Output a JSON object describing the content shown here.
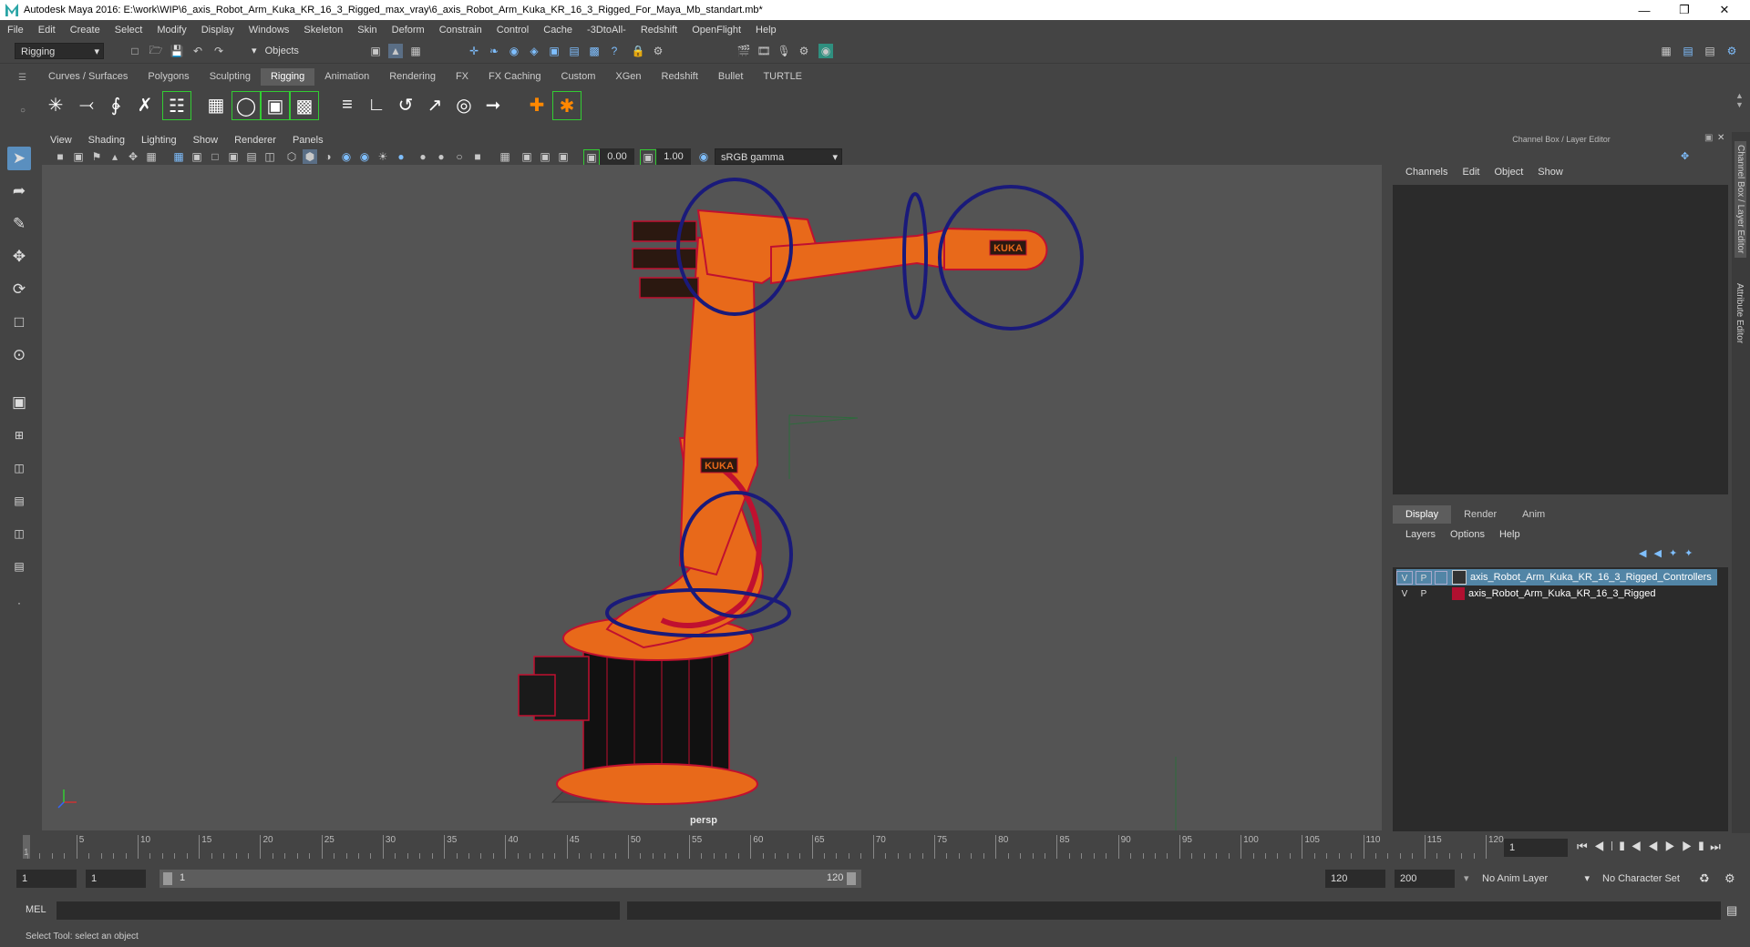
{
  "window": {
    "title": "Autodesk Maya 2016: E:\\work\\WIP\\6_axis_Robot_Arm_Kuka_KR_16_3_Rigged_max_vray\\6_axis_Robot_Arm_Kuka_KR_16_3_Rigged_For_Maya_Mb_standart.mb*"
  },
  "menubar": [
    "File",
    "Edit",
    "Create",
    "Select",
    "Modify",
    "Display",
    "Windows",
    "Skeleton",
    "Skin",
    "Deform",
    "Constrain",
    "Control",
    "Cache",
    "-3DtoAll-",
    "Redshift",
    "OpenFlight",
    "Help"
  ],
  "statusline": {
    "mode": "Rigging",
    "selection_mode": "Objects"
  },
  "shelf_tabs": [
    "Curves / Surfaces",
    "Polygons",
    "Sculpting",
    "Rigging",
    "Animation",
    "Rendering",
    "FX",
    "FX Caching",
    "Custom",
    "XGen",
    "Redshift",
    "Bullet",
    "TURTLE"
  ],
  "shelf_active": "Rigging",
  "panel_menu": [
    "View",
    "Shading",
    "Lighting",
    "Show",
    "Renderer",
    "Panels"
  ],
  "viewport_toolbar": {
    "value_a": "0.00",
    "value_b": "1.00",
    "color_space": "sRGB gamma"
  },
  "viewport": {
    "camera_label": "persp",
    "logo_text": "KUKA"
  },
  "channel_box": {
    "title": "Channel Box / Layer Editor",
    "menu": [
      "Channels",
      "Edit",
      "Object",
      "Show"
    ]
  },
  "layer_editor": {
    "tabs": [
      "Display",
      "Render",
      "Anim"
    ],
    "menu": [
      "Layers",
      "Options",
      "Help"
    ],
    "layers": [
      {
        "v": "V",
        "p": "P",
        "name": "axis_Robot_Arm_Kuka_KR_16_3_Rigged_Controllers",
        "color": "#5285a6",
        "selected": true
      },
      {
        "v": "V",
        "p": "P",
        "name": "axis_Robot_Arm_Kuka_KR_16_3_Rigged",
        "color": "#b01030",
        "selected": false
      }
    ]
  },
  "side_tabs": [
    "Channel Box / Layer Editor",
    "Attribute Editor"
  ],
  "timeline": {
    "ticks": [
      "5",
      "10",
      "15",
      "20",
      "25",
      "30",
      "35",
      "40",
      "45",
      "50",
      "55",
      "60",
      "65",
      "70",
      "75",
      "80",
      "85",
      "90",
      "95",
      "100",
      "105",
      "110",
      "115",
      "120"
    ],
    "first_frame": "1",
    "current_frame": "1"
  },
  "range": {
    "start": "1",
    "inner_start": "1",
    "slider_start": "1",
    "slider_end": "120",
    "end": "120",
    "max": "200",
    "anim_layer": "No Anim Layer",
    "char_set": "No Character Set"
  },
  "mel": {
    "label": "MEL"
  },
  "help_line": "Select Tool: select an object"
}
